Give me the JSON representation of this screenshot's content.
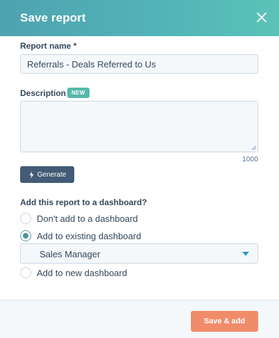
{
  "dialog": {
    "title": "Save report",
    "close_icon": "close-icon"
  },
  "report_name": {
    "label": "Report name *",
    "value": "Referrals - Deals Referred to Us"
  },
  "description": {
    "label": "Description",
    "badge": "NEW",
    "value": "",
    "char_count": "1000"
  },
  "generate": {
    "label": "Generate",
    "icon": "sparkle-bolt-icon"
  },
  "dashboard": {
    "question": "Add this report to a dashboard?",
    "options": [
      {
        "label": "Don't add to a dashboard",
        "checked": false
      },
      {
        "label": "Add to existing dashboard",
        "checked": true
      },
      {
        "label": "Add to new dashboard",
        "checked": false
      }
    ],
    "selected_dashboard": "Sales Manager"
  },
  "footer": {
    "save_label": "Save & add"
  },
  "colors": {
    "header_start": "#4ea3b0",
    "header_end": "#5cc2b8",
    "badge_new": "#55b8a8",
    "generate_button": "#425b76",
    "radio_checked": "#4a93a3",
    "select_caret": "#2e9ac6",
    "save_button": "#f08c6a",
    "text_primary": "#33475b"
  }
}
